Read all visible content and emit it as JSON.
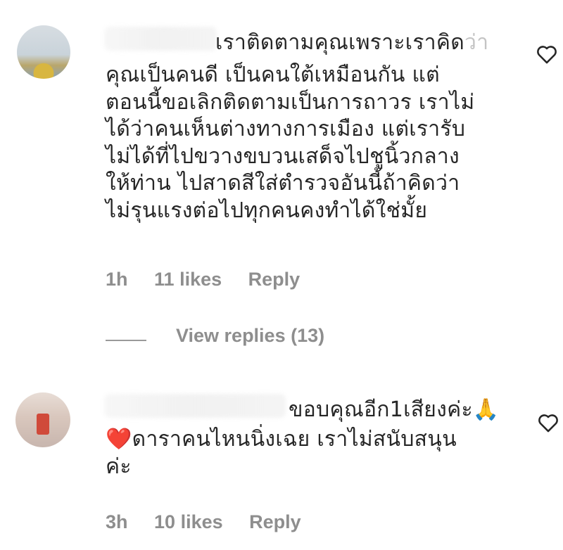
{
  "comments": [
    {
      "lines": [
        "เราติดตามคุณเพราะเราคิด",
        "คุณเป็นคนดี เป็นคนใต้เหมือนกัน แต่",
        "ตอนนี้ขอเลิกติดตามเป็นการถาวร เราไม่",
        "ได้ว่าคนเห็นต่างทางการเมือง แต่เรารับ",
        "ไม่ได้ที่ไปขวางขบวนเสด็จไปชูนิ้วกลาง",
        "ให้ท่าน ไปสาดสีใส่ตำรวจอันนี้ถ้าคิดว่า",
        "ไม่รุนแรงต่อไปทุกคนคงทำได้ใช่มั้ย"
      ],
      "line1_faded_tail": "ว่า",
      "time": "1h",
      "likes": "11 likes",
      "reply": "Reply",
      "view_replies": "View replies (13)"
    },
    {
      "line1": "ขอบคุณอีก1เสียงค่ะ",
      "line1_emoji": "🙏",
      "line2_emoji": "❤️",
      "line2": "ดาราคนไหนนิ่งเฉย เราไม่สนับสนุน",
      "line3": "ค่ะ",
      "time": "3h",
      "likes": "10 likes",
      "reply": "Reply"
    }
  ],
  "icons": {
    "like": "heart-outline-icon",
    "prayer": "folded-hands-emoji",
    "love": "red-heart-emoji"
  },
  "colors": {
    "text": "#262626",
    "meta": "#8e8e8e",
    "heart_emoji": "#e0201f"
  }
}
